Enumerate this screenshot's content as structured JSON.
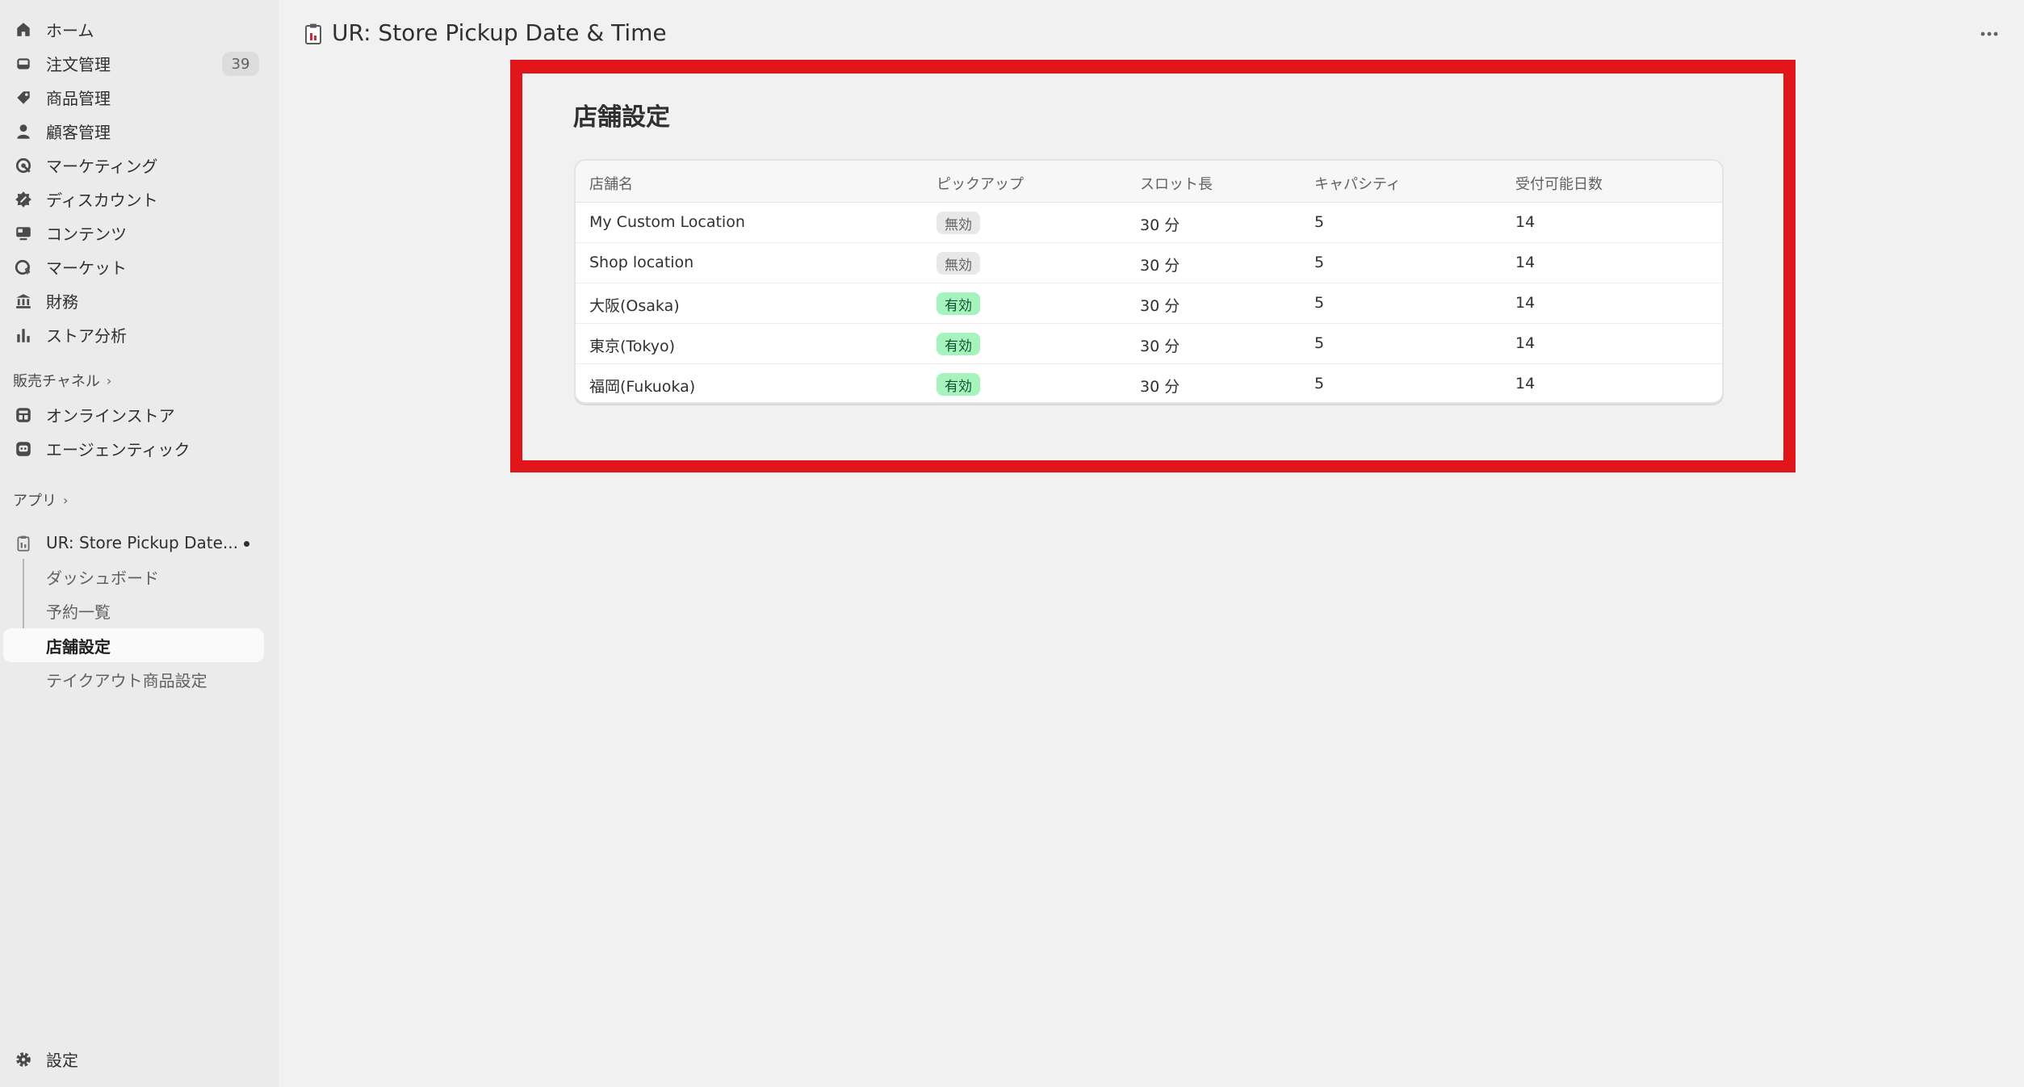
{
  "sidebar": {
    "items": [
      {
        "label": "ホーム",
        "icon": "home-icon"
      },
      {
        "label": "注文管理",
        "icon": "inbox-icon",
        "badge": "39"
      },
      {
        "label": "商品管理",
        "icon": "tag-icon"
      },
      {
        "label": "顧客管理",
        "icon": "person-icon"
      },
      {
        "label": "マーケティング",
        "icon": "target-icon"
      },
      {
        "label": "ディスカウント",
        "icon": "discount-icon"
      },
      {
        "label": "コンテンツ",
        "icon": "content-icon"
      },
      {
        "label": "マーケット",
        "icon": "globe-icon"
      },
      {
        "label": "財務",
        "icon": "bank-icon"
      },
      {
        "label": "ストア分析",
        "icon": "chart-bar-icon"
      }
    ],
    "sales_channels": {
      "heading": "販売チャネル",
      "items": [
        {
          "label": "オンラインストア",
          "icon": "store-icon"
        },
        {
          "label": "エージェンティック",
          "icon": "agent-icon"
        }
      ]
    },
    "apps": {
      "heading": "アプリ",
      "app_name": "UR: Store Pickup Date...",
      "sub_items": [
        {
          "label": "ダッシュボード"
        },
        {
          "label": "予約一覧"
        },
        {
          "label": "店舗設定",
          "active": true
        },
        {
          "label": "テイクアウト商品設定"
        }
      ]
    },
    "settings_label": "設定"
  },
  "header": {
    "title": "UR: Store Pickup Date & Time",
    "more_icon": "more-horizontal-icon"
  },
  "main": {
    "card_title": "店舗設定",
    "table": {
      "columns": [
        "店舗名",
        "ピックアップ",
        "スロット長",
        "キャパシティ",
        "受付可能日数"
      ],
      "rows": [
        {
          "name": "My Custom Location",
          "pickup": "無効",
          "pickup_enabled": false,
          "slot": "30 分",
          "capacity": "5",
          "days": "14"
        },
        {
          "name": "Shop location",
          "pickup": "無効",
          "pickup_enabled": false,
          "slot": "30 分",
          "capacity": "5",
          "days": "14"
        },
        {
          "name": "大阪(Osaka)",
          "pickup": "有効",
          "pickup_enabled": true,
          "slot": "30 分",
          "capacity": "5",
          "days": "14"
        },
        {
          "name": "東京(Tokyo)",
          "pickup": "有効",
          "pickup_enabled": true,
          "slot": "30 分",
          "capacity": "5",
          "days": "14"
        },
        {
          "name": "福岡(Fukuoka)",
          "pickup": "有効",
          "pickup_enabled": true,
          "slot": "30 分",
          "capacity": "5",
          "days": "14"
        }
      ]
    }
  },
  "colors": {
    "highlight": "#e0161b",
    "enabled_badge": "#a7f3bd",
    "disabled_badge": "#e8e8e8"
  }
}
